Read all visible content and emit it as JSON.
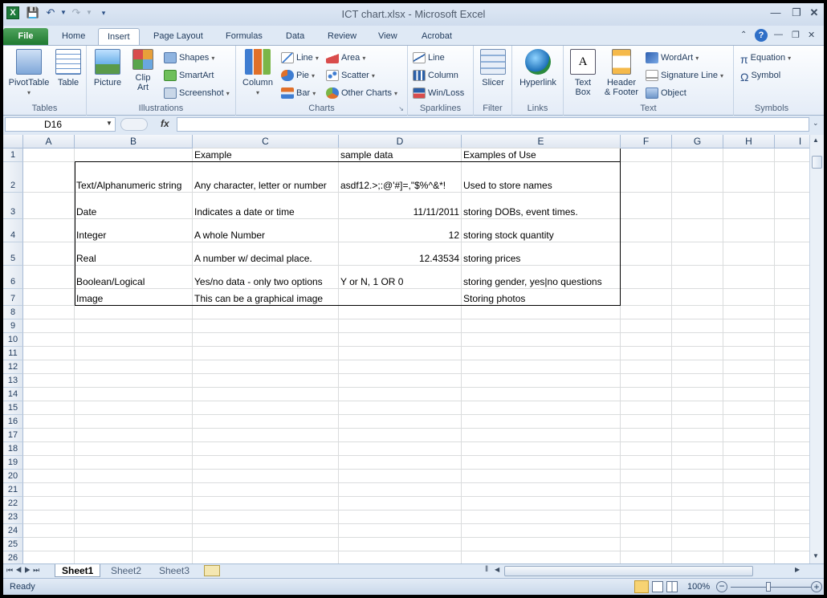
{
  "titlebar": {
    "title": "ICT chart.xlsx  -  Microsoft Excel",
    "app_icon": "X"
  },
  "tabs": [
    "File",
    "Home",
    "Insert",
    "Page Layout",
    "Formulas",
    "Data",
    "Review",
    "View",
    "Acrobat"
  ],
  "ribbon": {
    "pivottable": "PivotTable",
    "table": "Table",
    "tables_group": "Tables",
    "picture": "Picture",
    "clip_art_1": "Clip",
    "clip_art_2": "Art",
    "shapes": "Shapes",
    "smartart": "SmartArt",
    "screenshot": "Screenshot",
    "illustrations_group": "Illustrations",
    "column": "Column",
    "line": "Line",
    "pie": "Pie",
    "bar": "Bar",
    "area": "Area",
    "scatter": "Scatter",
    "other_charts": "Other Charts",
    "charts_group": "Charts",
    "spark_line": "Line",
    "spark_column": "Column",
    "spark_winloss": "Win/Loss",
    "sparklines_group": "Sparklines",
    "slicer": "Slicer",
    "filter_group": "Filter",
    "hyperlink": "Hyperlink",
    "links_group": "Links",
    "textbox_1": "Text",
    "textbox_2": "Box",
    "header_1": "Header",
    "header_2": "& Footer",
    "wordart": "WordArt",
    "signature": "Signature Line",
    "object": "Object",
    "text_group": "Text",
    "equation": "Equation",
    "symbol": "Symbol",
    "symbols_group": "Symbols"
  },
  "formula_bar": {
    "name_box": "D16",
    "fx": "fx",
    "formula": ""
  },
  "grid": {
    "columns": [
      "A",
      "B",
      "C",
      "D",
      "E",
      "F",
      "G",
      "H",
      "I"
    ],
    "rows": [
      "1",
      "2",
      "3",
      "4",
      "5",
      "6",
      "7",
      "8",
      "9",
      "10",
      "11",
      "12",
      "13",
      "14",
      "15",
      "16",
      "17",
      "18",
      "19",
      "20",
      "21",
      "22",
      "23",
      "24",
      "25",
      "26"
    ],
    "cells": {
      "C1": "Example",
      "D1": "sample data",
      "E1": "Examples of Use",
      "B2": "Text/Alphanumeric string",
      "C2": "Any character, letter or number",
      "D2": "asdf12.>;:@'#]=,\"$%^&*!",
      "E2": "Used to store names",
      "B3": "Date",
      "C3": "Indicates a date or time",
      "D3": "11/11/2011",
      "E3": "storing DOBs, event times.",
      "B4": "Integer",
      "C4": "A whole Number",
      "D4": "12",
      "E4": "storing stock quantity",
      "B5": "Real",
      "C5": "A number w/ decimal place.",
      "D5": "12.43534",
      "E5": "storing prices",
      "B6": "Boolean/Logical",
      "C6": "Yes/no data - only two options",
      "D6": "Y or N, 1 OR 0",
      "E6": "storing gender, yes|no questions",
      "B7": "Image",
      "C7": "This can be a graphical image",
      "E7": "Storing photos"
    }
  },
  "sheets": [
    "Sheet1",
    "Sheet2",
    "Sheet3"
  ],
  "status": {
    "ready": "Ready",
    "zoom": "100%"
  }
}
